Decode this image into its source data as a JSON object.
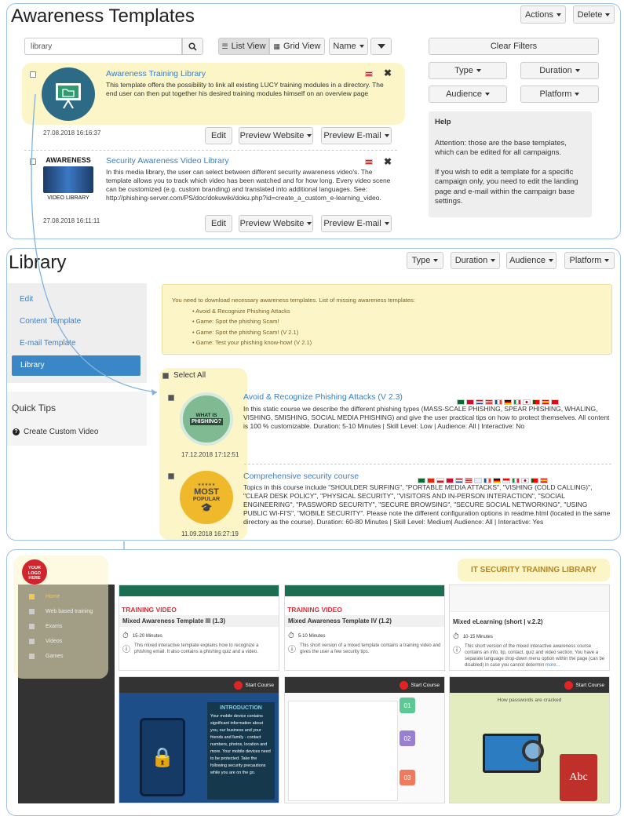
{
  "templates": {
    "title": "Awareness Templates",
    "actions_label": "Actions",
    "delete_label": "Delete",
    "search_value": "library",
    "list_view_label": "List View",
    "grid_view_label": "Grid View",
    "name_label": "Name",
    "clear_filters_label": "Clear Filters",
    "filters": [
      "Type",
      "Duration",
      "Audience",
      "Platform"
    ],
    "items": [
      {
        "title": "Awareness Training Library",
        "description": "This template offers the possibility to link all existing LUCY training modules in a directory. The end user can then put together his desired training modules himself on an overview page",
        "timestamp": "27.08.2018 16:16:37"
      },
      {
        "title": "Security Awareness Video Library",
        "description": "In this media library, the user can select between different security awareness video's. The template allows you to track which video has been watched and for how long. Every video scene can be customized (e.g. custom branding) and translated into additional languages. See: http://phishing-server.com/PS/doc/dokuwiki/doku.php?id=create_a_custom_e-learning_video.",
        "timestamp": "27.08.2018 16:11:11",
        "thumb_top": "AWARENESS",
        "thumb_bottom": "VIDEO LIBRARY"
      }
    ],
    "edit_label": "Edit",
    "preview_website_label": "Preview Website",
    "preview_email_label": "Preview E-mail",
    "help": {
      "title": "Help",
      "p1": "Attention: those are the base templates, which can be edited for all campaigns.",
      "p2": "If you wish to edit a template for a specific campaign only, you need to edit the landing page and e-mail within the campaign base settings."
    }
  },
  "library": {
    "title": "Library",
    "filters": [
      "Type",
      "Duration",
      "Audience",
      "Platform"
    ],
    "nav": [
      "Edit",
      "Content Template",
      "E-mail Template",
      "Library"
    ],
    "quick_tips_title": "Quick Tips",
    "quick_tip": "Create Custom Video",
    "notice_intro": "You need to download necessary awareness templates. List of missing awareness templates:",
    "notice_items": [
      "Avoid & Recognize Phishing Attacks",
      "Game: Spot the phishing Scam!",
      "Game: Spot the phishing Scam! (V 2.1)",
      "Game: Test your phishing know-how! (V 2.1)"
    ],
    "select_all": "Select All",
    "courses": [
      {
        "title": "Avoid & Recognize Phishing Attacks (V 2.3)",
        "description": "In this static course we describe the different phishing types (MASS-SCALE PHISHING, SPEAR PHISHING, WHALING, VISHING, SMISHING, SOCIAL MEDIA PHISHING) and give the user practical tips on how to protect themselves. All content is 100 % customizable. Duration: 5-10 Minutes | Skill Level: Low | Audience: All | Interactive: No",
        "timestamp": "17.12.2018 17:12:51",
        "badge_top": "WHAT IS",
        "badge_bottom": "PHISHING?"
      },
      {
        "title": "Comprehensive security course",
        "description": "Topics in this course include \"SHOULDER SURFING\", \"PORTABLE MEDIA ATTACKS\", \"VISHING (COLD CALLING)\", \"CLEAR DESK POLICY\", \"PHYSICAL SECURITY\", \"VISITORS AND IN-PERSON INTERACTION\", \"SOCIAL ENGINEERING\", \"PASSWORD SECURITY\", \"SECURE BROWSING\", \"SECURE SOCIAL NETWORKING\", \"USING PUBLIC WI-FI'S\", \"MOBILE SECURITY\". Please note the different configuration options in readme.html (located in the same directory as the course). Duration: 60-80 Minutes | Skill Level: Medium| Audience: All | Interactive: Yes",
        "timestamp": "11.09.2018 16:27:19",
        "badge_top": "MOST",
        "badge_bottom": "POPULAR"
      }
    ]
  },
  "portal": {
    "logo_line1": "YOUR",
    "logo_line2": "LOGO",
    "logo_line3": "HERE",
    "banner": "IT SECURITY TRAINING LIBRARY",
    "menu": [
      "Home",
      "Web based training",
      "Exams",
      "Videos",
      "Games"
    ],
    "cards": [
      {
        "tag": "TRAINING VIDEO",
        "title": "Mixed Awareness Template III (1.3)",
        "duration": "15-20 Minutes",
        "desc": "This mixed interactive template explains how to recognize a phishing email. It also contains a phishing quiz and a video."
      },
      {
        "tag": "TRAINING VIDEO",
        "title": "Mixed Awareness Template IV (1.2)",
        "duration": "5-10 Minutes",
        "desc": "This short version of a mixed template contains a training video and gives the user a few security tips."
      },
      {
        "tag": "",
        "title": "Mixed eLearning (short | v.2.2)",
        "duration": "10-15 Minutes",
        "desc": "This short version of the mixed interactive awareness course contains an info, tip, contact, quiz and video section. You have a separate language drop-down menu option within the page (can be disabled) in case you cannot determin",
        "more": "more..."
      }
    ],
    "start_course": "Start Course",
    "intro_title": "INTRODUCTION",
    "intro_text": "Your mobile device contains significant information about you, our business and your friends and family - contact numbers, photos, location and more. Your mobile devices need to be protected. Take the following security precautions while you are on the go.",
    "pw_title": "How passwords are cracked",
    "abc": "Abc",
    "steps": [
      "01",
      "02",
      "03"
    ]
  },
  "colors": {
    "panel_border": "#9ec3e6",
    "highlight": "#fbf5c8",
    "active_nav": "#3a87c8",
    "link": "#3b7fc4"
  }
}
